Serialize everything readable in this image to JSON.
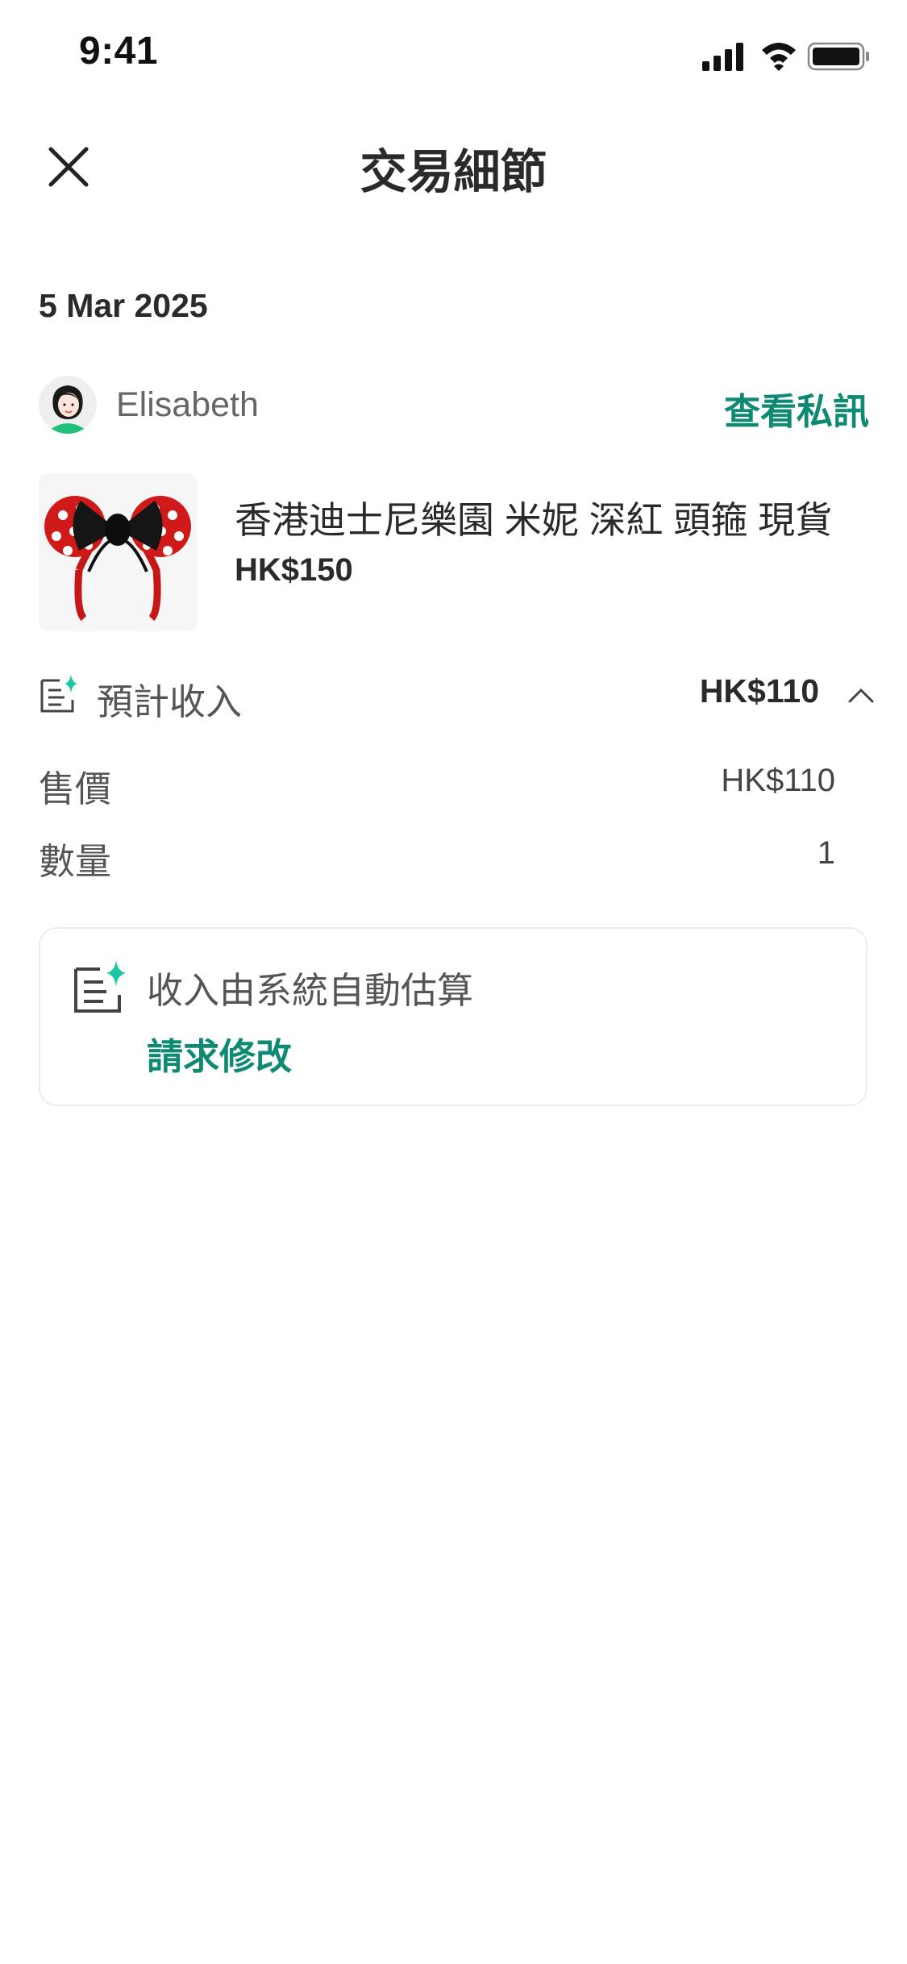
{
  "status_bar": {
    "time": "9:41"
  },
  "header": {
    "title": "交易細節",
    "close_icon": "close-icon"
  },
  "transaction": {
    "date": "5 Mar 2025",
    "user": {
      "name": "Elisabeth",
      "view_messages_label": "查看私訊"
    },
    "product": {
      "title": "香港迪士尼樂園 米妮 深紅 頭箍 現貨",
      "price": "HK$150"
    },
    "income": {
      "label": "預計收入",
      "value": "HK$110",
      "expanded": true,
      "lines": [
        {
          "label": "售價",
          "value": "HK$110"
        },
        {
          "label": "數量",
          "value": "1"
        }
      ]
    },
    "notice": {
      "text": "收入由系統自動估算",
      "link_label": "請求修改"
    }
  },
  "colors": {
    "accent": "#0e8a72",
    "icon_sparkle": "#1fc4a0",
    "text_primary": "#2a2a2a",
    "text_secondary": "#555555"
  }
}
